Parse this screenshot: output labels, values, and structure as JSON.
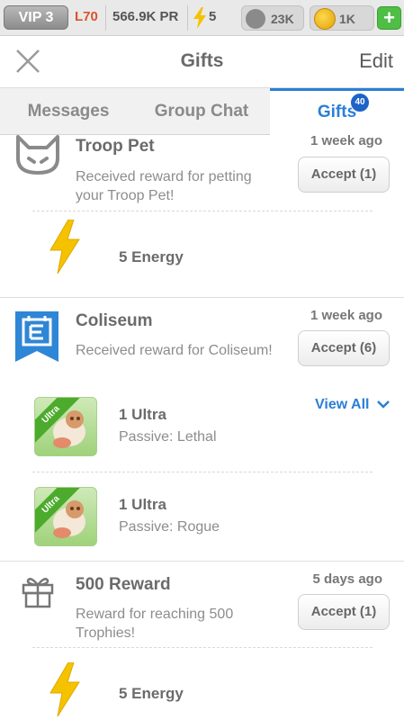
{
  "status_bar": {
    "vip": "VIP 3",
    "level": "L70",
    "power": "566.9K PR",
    "energy": "5",
    "paws": "23K",
    "coins": "1K",
    "plus": "+"
  },
  "header": {
    "title": "Gifts",
    "edit_label": "Edit"
  },
  "tabs": [
    {
      "label": "Messages"
    },
    {
      "label": "Group Chat"
    },
    {
      "label": "Gifts",
      "badge": "40"
    }
  ],
  "gifts": [
    {
      "title": "Troop Pet",
      "time": "1 week ago",
      "description": "Received reward for petting your Troop Pet!",
      "accept_label": "Accept (1)",
      "rewards": [
        {
          "title": "5 Energy"
        }
      ]
    },
    {
      "title": "Coliseum",
      "time": "1 week ago",
      "description": "Received reward for Coliseum!",
      "accept_label": "Accept (6)",
      "view_all": "View All",
      "rewards": [
        {
          "title": "1 Ultra",
          "subtitle": "Passive: Lethal",
          "badge": "Ultra"
        },
        {
          "title": "1 Ultra",
          "subtitle": "Passive: Rogue",
          "badge": "Ultra"
        }
      ]
    },
    {
      "title": "500 Reward",
      "time": "5 days ago",
      "description": "Reward for reaching 500 Trophies!",
      "accept_label": "Accept (1)",
      "rewards": [
        {
          "title": "5 Energy"
        }
      ]
    }
  ],
  "colors": {
    "accent": "#2a7fd6",
    "badge": "#1d63c8",
    "energy": "#f5c200",
    "plus": "#4fbe45"
  }
}
